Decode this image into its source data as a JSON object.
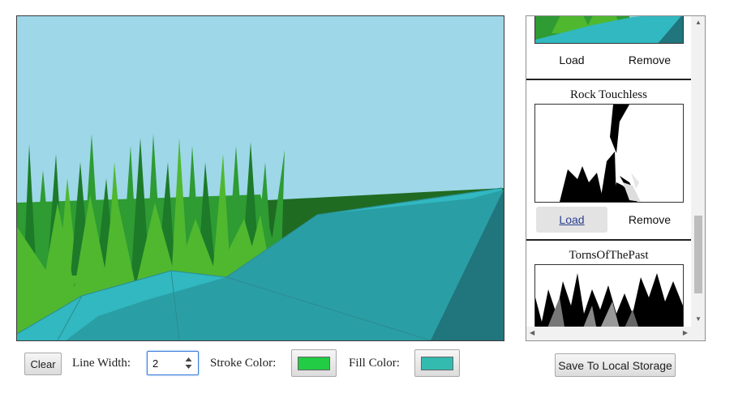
{
  "canvas": {
    "colors": {
      "sky": "#9ed7e8",
      "hill": "#1f6b22",
      "grass_light": "#4fb82f",
      "grass_mid": "#2e9b33",
      "grass_dark": "#1d7a28",
      "rock_light": "#31b8c0",
      "rock_mid": "#2a9ea5",
      "rock_dark": "#21757c"
    }
  },
  "controls": {
    "clear_label": "Clear",
    "line_width_label": "Line Width:",
    "line_width_value": "2",
    "stroke_label": "Stroke Color:",
    "stroke_color": "#22cc44",
    "fill_label": "Fill Color:",
    "fill_color": "#33bbb0"
  },
  "gallery": {
    "items": [
      {
        "title": "",
        "load_label": "Load",
        "remove_label": "Remove"
      },
      {
        "title": "Rock Touchless",
        "load_label": "Load",
        "remove_label": "Remove"
      },
      {
        "title": "TornsOfThePast"
      }
    ]
  },
  "save_label": "Save To Local Storage"
}
